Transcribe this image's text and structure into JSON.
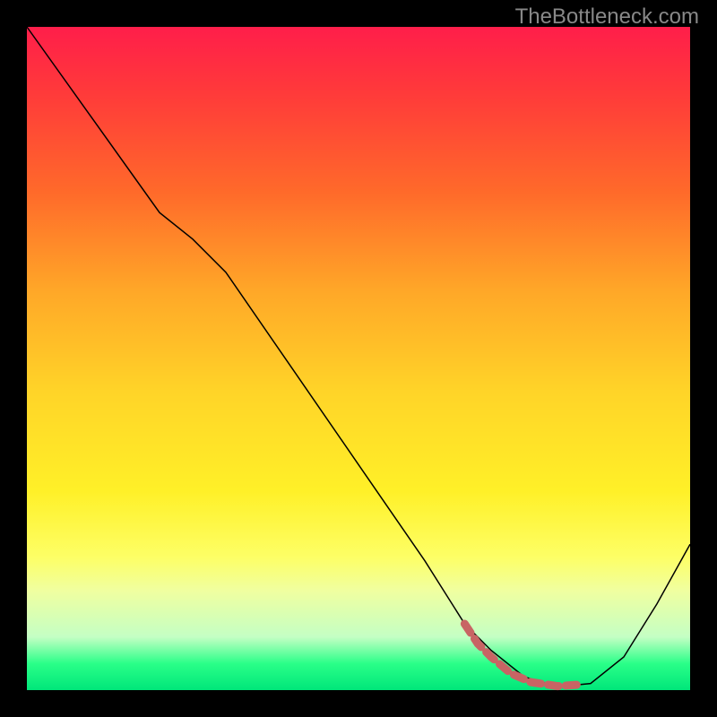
{
  "watermark": "TheBottleneck.com",
  "chart_data": {
    "type": "line",
    "title": "",
    "xlabel": "",
    "ylabel": "",
    "xlim": [
      0,
      100
    ],
    "ylim": [
      0,
      100
    ],
    "series": [
      {
        "name": "bottleneck-curve",
        "color": "#000000",
        "x": [
          0,
          10,
          20,
          25,
          30,
          40,
          50,
          60,
          66,
          70,
          75,
          80,
          85,
          90,
          95,
          100
        ],
        "y": [
          100,
          86,
          72,
          68,
          63,
          48.5,
          34,
          19.5,
          10,
          6,
          2,
          0.5,
          1,
          5,
          13,
          22
        ]
      },
      {
        "name": "highlight-segment",
        "color": "#c86464",
        "style": "dashed-thick",
        "x": [
          66,
          67,
          68,
          70,
          73,
          76,
          80,
          83
        ],
        "y": [
          10,
          8.5,
          7,
          5,
          2.5,
          1.2,
          0.6,
          0.8
        ]
      }
    ],
    "gradient_background": {
      "top": "#ff1e4a",
      "middle": "#ffd428",
      "bottom": "#00e67a"
    }
  }
}
